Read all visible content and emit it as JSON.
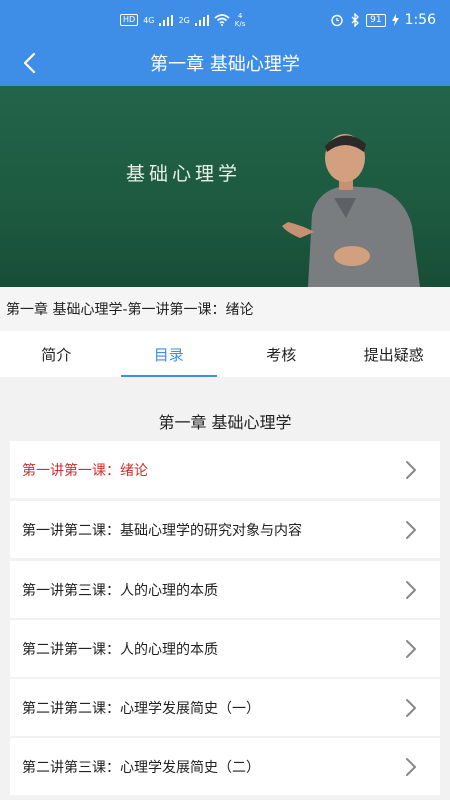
{
  "status": {
    "network_badge": "HD",
    "sim1": "4G",
    "sim2": "2G",
    "speed": "4\nK/s",
    "battery": "91",
    "time": "1:56"
  },
  "nav": {
    "title": "第一章 基础心理学"
  },
  "video": {
    "board_text": "基础心理学"
  },
  "video_title": "第一章 基础心理学-第一讲第一课：绪论",
  "tabs": [
    {
      "label": "简介"
    },
    {
      "label": "目录"
    },
    {
      "label": "考核"
    },
    {
      "label": "提出疑惑"
    }
  ],
  "chapter": {
    "title": "第一章 基础心理学",
    "lessons": [
      {
        "label": "第一讲第一课：绪论"
      },
      {
        "label": "第一讲第二课：基础心理学的研究对象与内容"
      },
      {
        "label": "第一讲第三课：人的心理的本质"
      },
      {
        "label": "第二讲第一课：人的心理的本质"
      },
      {
        "label": "第二讲第二课：心理学发展简史（一）"
      },
      {
        "label": "第二讲第三课：心理学发展简史（二）"
      }
    ]
  },
  "colors": {
    "accent": "#3e8ee8",
    "current_lesson": "#d0312d"
  }
}
